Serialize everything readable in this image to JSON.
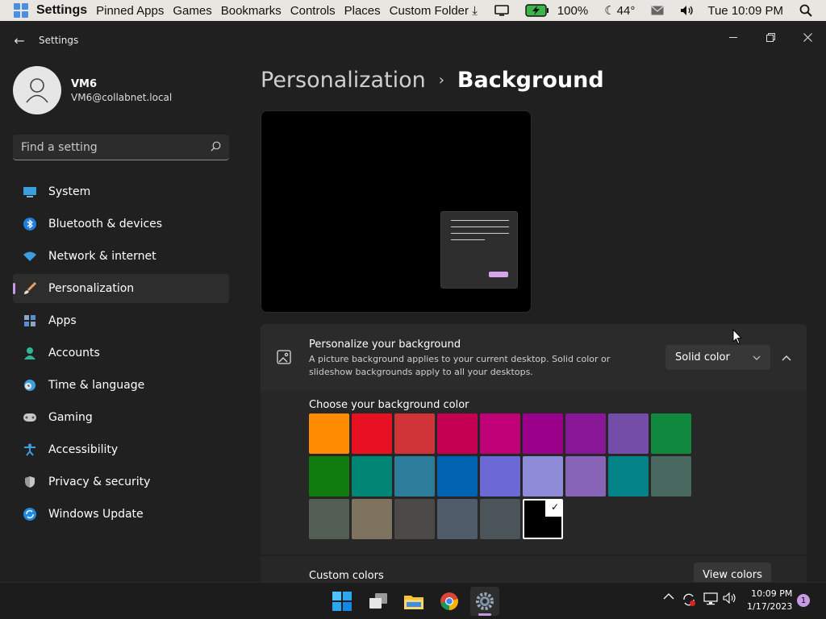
{
  "menubar": {
    "items": [
      "Settings",
      "Pinned Apps",
      "Games",
      "Bookmarks",
      "Controls",
      "Places",
      "Custom Folder"
    ],
    "battery": "100%",
    "weather": "44°",
    "datetime": "Tue 10:09 PM"
  },
  "window": {
    "title": "Settings"
  },
  "profile": {
    "name": "VM6",
    "email": "VM6@collabnet.local"
  },
  "search": {
    "placeholder": "Find a setting"
  },
  "nav": {
    "items": [
      {
        "label": "System",
        "icon": "monitor-icon"
      },
      {
        "label": "Bluetooth & devices",
        "icon": "bluetooth-icon"
      },
      {
        "label": "Network & internet",
        "icon": "wifi-icon"
      },
      {
        "label": "Personalization",
        "icon": "brush-icon",
        "active": true
      },
      {
        "label": "Apps",
        "icon": "apps-icon"
      },
      {
        "label": "Accounts",
        "icon": "person-icon"
      },
      {
        "label": "Time & language",
        "icon": "clock-globe-icon"
      },
      {
        "label": "Gaming",
        "icon": "gamepad-icon"
      },
      {
        "label": "Accessibility",
        "icon": "accessibility-icon"
      },
      {
        "label": "Privacy & security",
        "icon": "shield-icon"
      },
      {
        "label": "Windows Update",
        "icon": "sync-icon"
      }
    ]
  },
  "breadcrumb": {
    "parent": "Personalization",
    "separator": "›",
    "current": "Background"
  },
  "background_card": {
    "title": "Personalize your background",
    "description": "A picture background applies to your current desktop. Solid color or slideshow backgrounds apply to all your desktops.",
    "selected_type": "Solid color",
    "color_section_title": "Choose your background color",
    "custom_colors_label": "Custom colors",
    "view_colors_label": "View colors",
    "selected_index": 23,
    "colors": [
      "#ff8c00",
      "#e81123",
      "#d13438",
      "#c30052",
      "#bf0077",
      "#9a0089",
      "#881798",
      "#744da9",
      "#10893e",
      "#107c10",
      "#018574",
      "#2d7d9a",
      "#0063b1",
      "#6b69d6",
      "#8e8cd8",
      "#8764b8",
      "#038387",
      "#486860",
      "#525e54",
      "#7e735f",
      "#4c4a48",
      "#515c6b",
      "#4a5459",
      "#000000"
    ]
  },
  "taskbar": {
    "apps": [
      "windows-start-icon",
      "task-view-icon",
      "file-explorer-icon",
      "chrome-icon",
      "settings-icon"
    ],
    "time": "10:09 PM",
    "date": "1/17/2023",
    "notifications": "1"
  }
}
